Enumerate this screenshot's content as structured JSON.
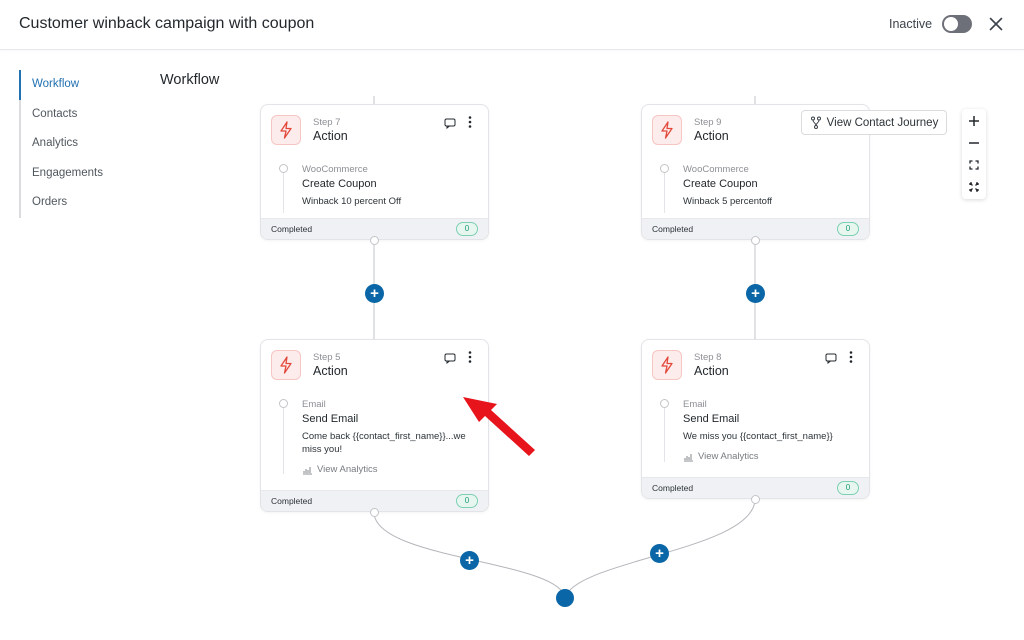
{
  "header": {
    "title": "Customer winback campaign with coupon",
    "status_label": "Inactive",
    "close_icon": "close-icon"
  },
  "sidebar": {
    "items": [
      {
        "label": "Workflow",
        "active": true
      },
      {
        "label": "Contacts",
        "active": false
      },
      {
        "label": "Analytics",
        "active": false
      },
      {
        "label": "Engagements",
        "active": false
      },
      {
        "label": "Orders",
        "active": false
      }
    ]
  },
  "main": {
    "title": "Workflow",
    "journey_button": "View Contact Journey",
    "zoom_controls": [
      "zoom-in-icon",
      "zoom-out-icon",
      "fit-view-icon",
      "fullscreen-icon"
    ]
  },
  "steps": {
    "step7": {
      "step": "Step 7",
      "type": "Action",
      "provider": "WooCommerce",
      "name": "Create Coupon",
      "detail": "Winback 10 percent Off",
      "status": "Completed",
      "count": "0"
    },
    "step9": {
      "step": "Step 9",
      "type": "Action",
      "provider": "WooCommerce",
      "name": "Create Coupon",
      "detail": "Winback 5 percentoff",
      "status": "Completed",
      "count": "0"
    },
    "step5": {
      "step": "Step 5",
      "type": "Action",
      "provider": "Email",
      "name": "Send Email",
      "detail": "Come back {{contact_first_name}}...we miss you!",
      "analytics": "View Analytics",
      "status": "Completed",
      "count": "0"
    },
    "step8": {
      "step": "Step 8",
      "type": "Action",
      "provider": "Email",
      "name": "Send Email",
      "detail": "We miss you {{contact_first_name}}",
      "analytics": "View Analytics",
      "status": "Completed",
      "count": "0"
    }
  },
  "colors": {
    "accent": "#2271b1",
    "plus_button": "#0a66a6",
    "action_icon": "#e2493b",
    "badge": "#1a9b72",
    "annotation_arrow": "#e8141c"
  }
}
